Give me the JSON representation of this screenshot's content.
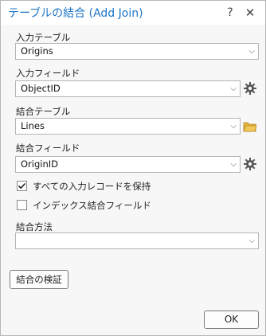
{
  "window": {
    "title": "テーブルの結合 (Add Join)",
    "help_glyph": "?",
    "close_glyph": "✕"
  },
  "input_table": {
    "label": "入力テーブル",
    "value": "Origins"
  },
  "input_field": {
    "label": "入力フィールド",
    "value": "ObjectID",
    "side_icon": "gear-icon"
  },
  "join_table": {
    "label": "結合テーブル",
    "value": "Lines",
    "side_icon": "folder-icon"
  },
  "join_field": {
    "label": "結合フィールド",
    "value": "OriginID",
    "side_icon": "gear-icon"
  },
  "keep_all_records": {
    "label": "すべての入力レコードを保持",
    "checked": true
  },
  "index_join_fields": {
    "label": "インデックス結合フィールド",
    "checked": false
  },
  "join_operation": {
    "label": "結合方法",
    "value": ""
  },
  "buttons": {
    "validate": "結合の検証",
    "ok": "OK"
  },
  "colors": {
    "title": "#1b74c6",
    "folder": "#e3b341",
    "gear": "#555555"
  }
}
